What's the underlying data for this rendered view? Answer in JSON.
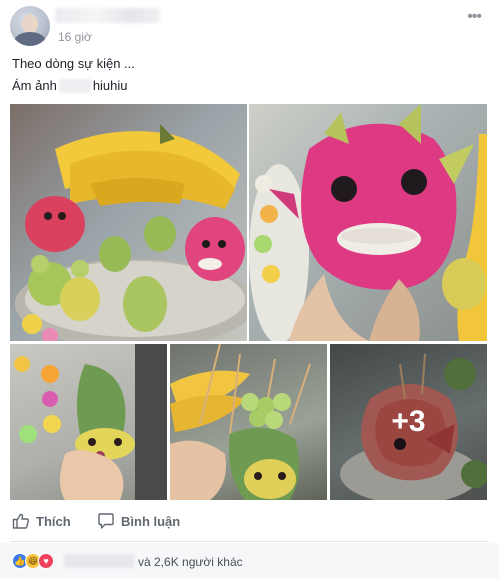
{
  "post": {
    "timestamp": "16 giờ",
    "more_label": "•••",
    "text_line1": "Theo dòng sự kiện ...",
    "text_line2_prefix": "Ám ảnh",
    "text_line2_suffix": "hiuhiu"
  },
  "gallery": {
    "more_count": "+3"
  },
  "actions": {
    "like_label": "Thích",
    "comment_label": "Bình luận"
  },
  "reactions": {
    "others_text": "và 2,6K người khác",
    "icons": [
      "like-icon",
      "haha-icon",
      "love-icon"
    ]
  },
  "colors": {
    "text": "#1d2129",
    "meta": "#90949c",
    "action": "#606770",
    "reaction_bar": "#f6f7f9"
  }
}
